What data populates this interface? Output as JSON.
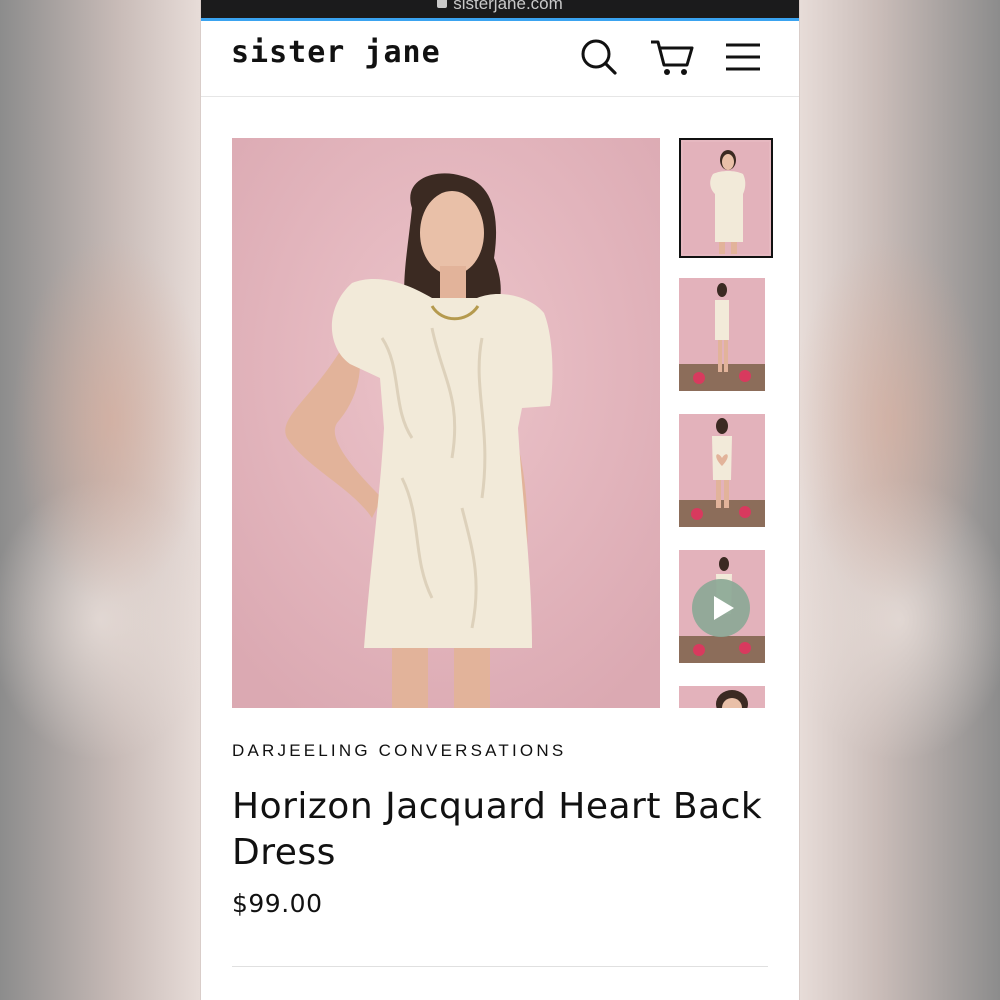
{
  "browser": {
    "url": "sisterjane.com"
  },
  "header": {
    "logo_text": "sister jane",
    "icons": [
      "search-icon",
      "cart-icon",
      "menu-icon"
    ]
  },
  "gallery": {
    "thumbnails": [
      "front-view",
      "side-view",
      "back-view",
      "video",
      "detail-view"
    ],
    "active_index": 0
  },
  "product": {
    "vendor": "DARJEELING CONVERSATIONS",
    "title": "Horizon Jacquard Heart Back Dress",
    "price": "$99.00"
  },
  "colors": {
    "accent": "#3aa3f0",
    "backdrop": "#e6b8c0",
    "text": "#111111"
  }
}
